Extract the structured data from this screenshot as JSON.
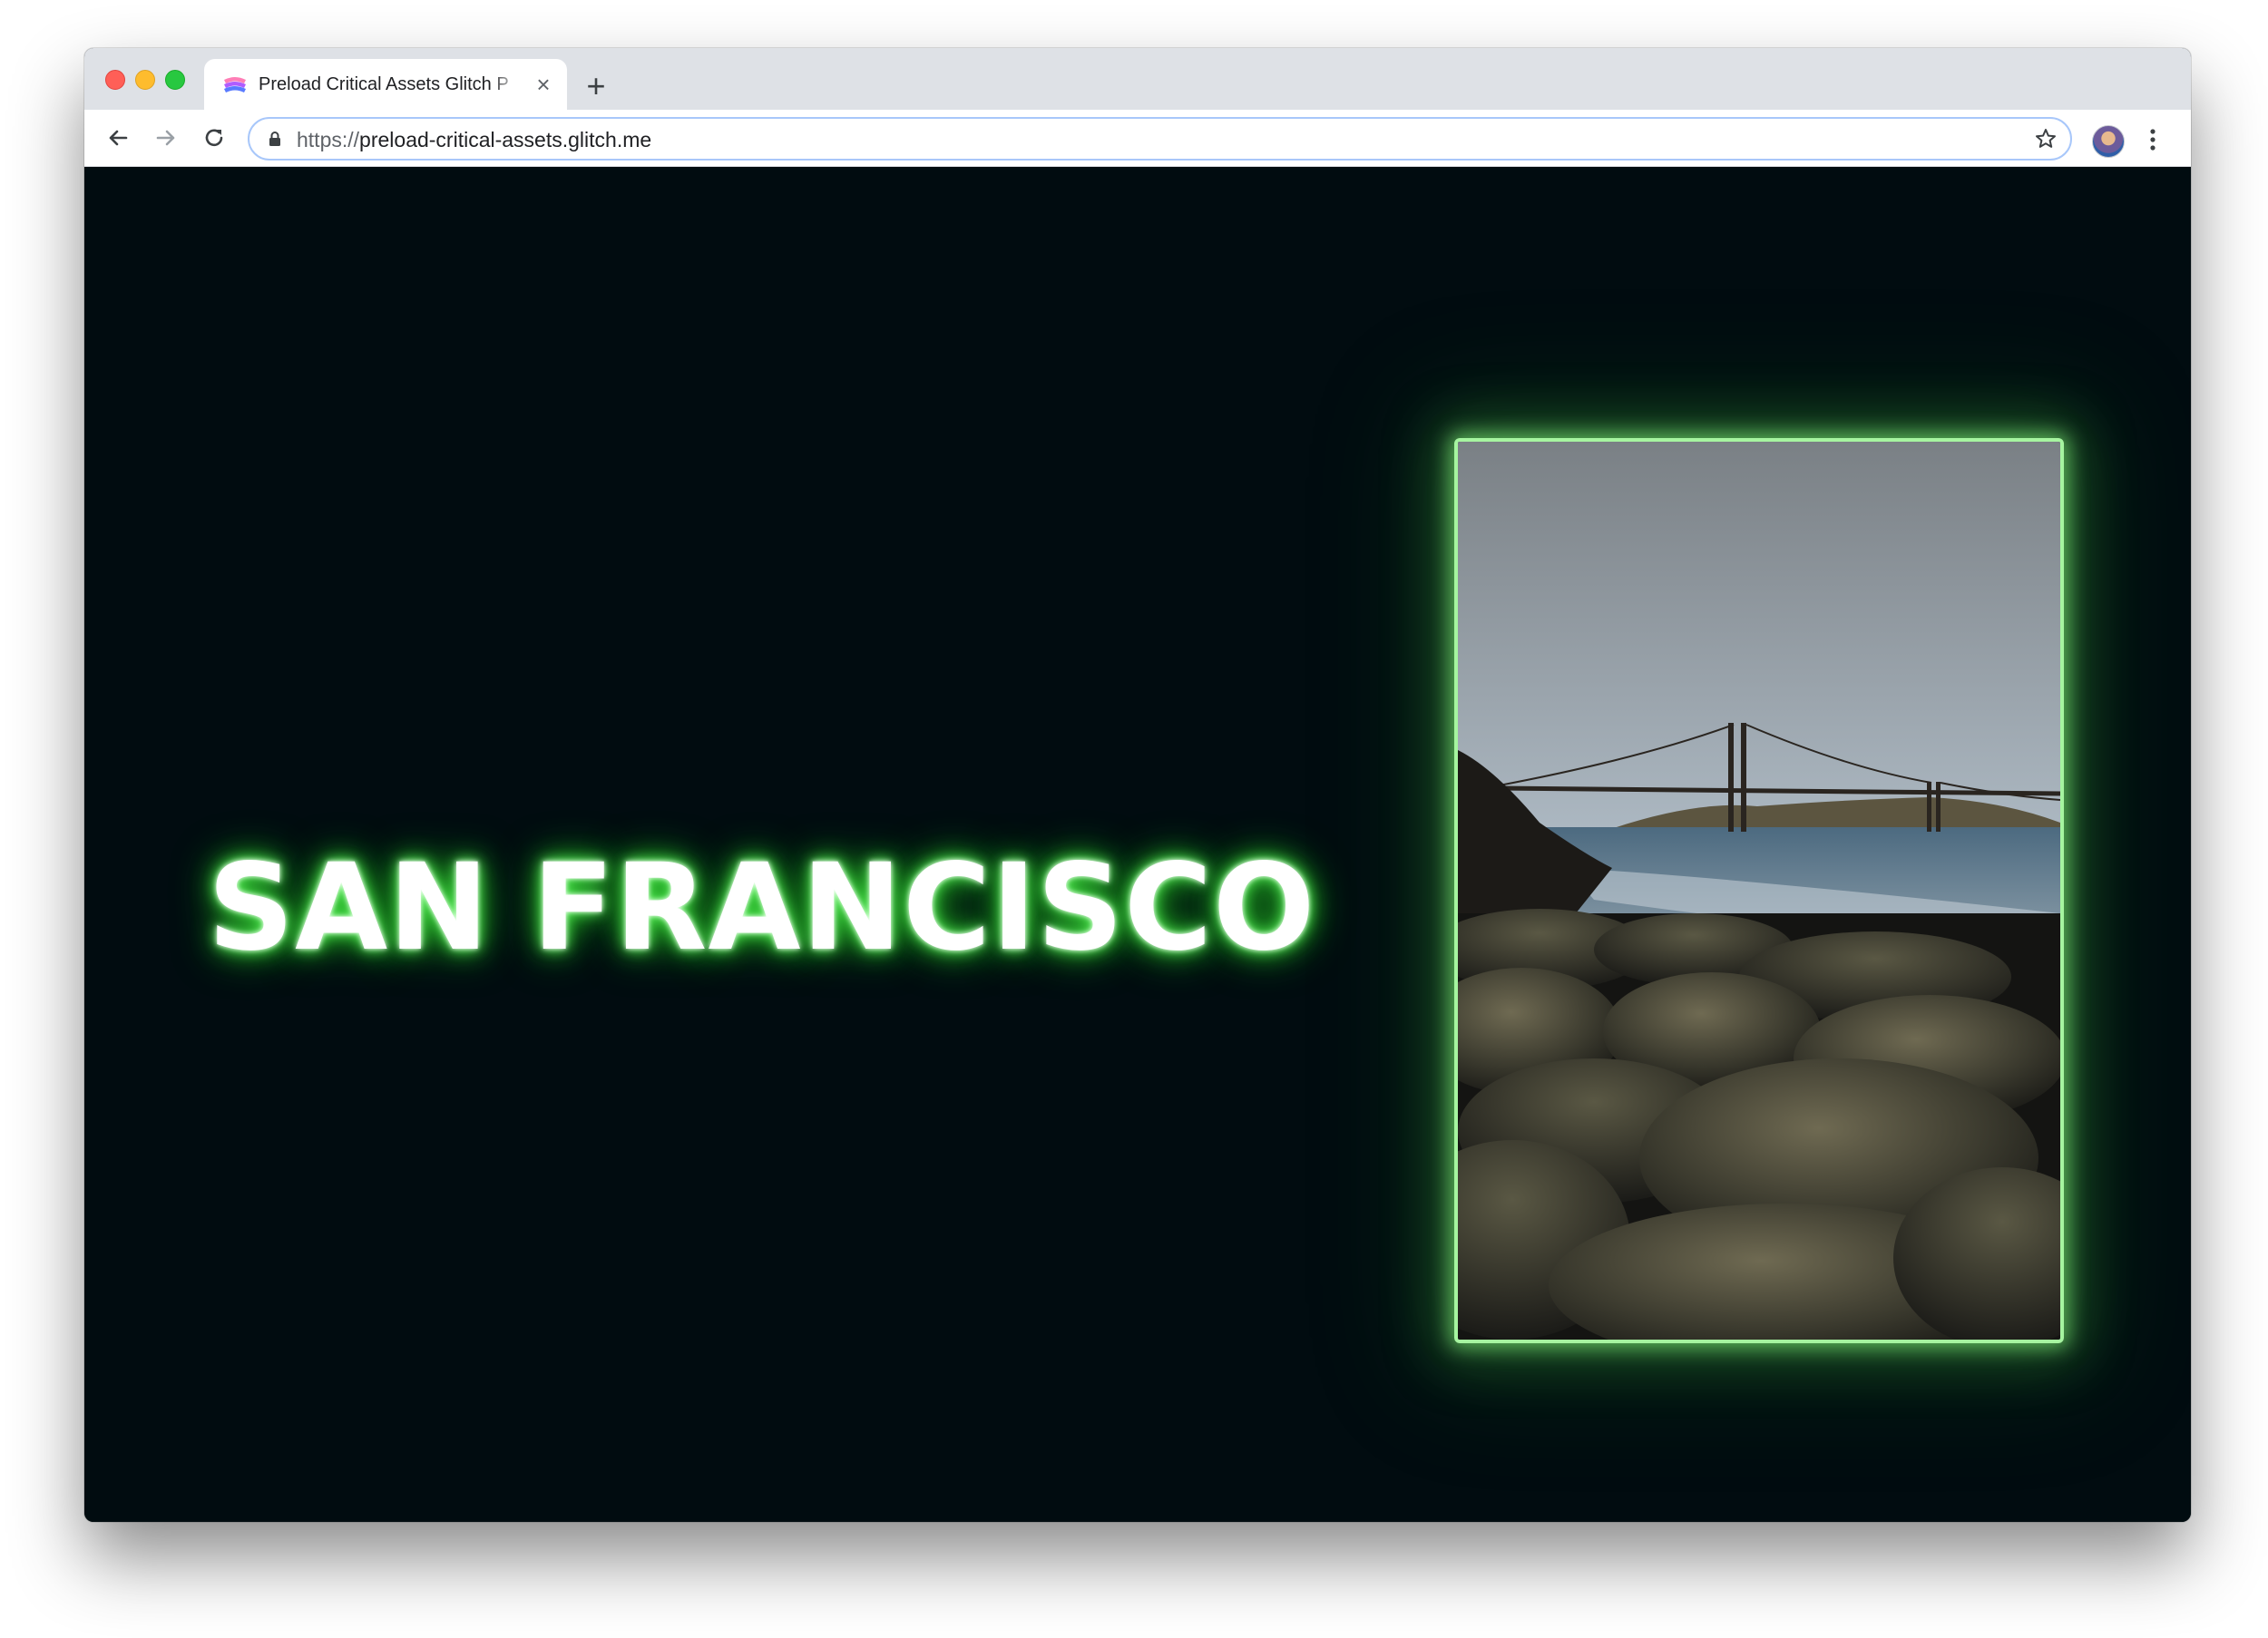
{
  "browser": {
    "tab": {
      "title": "Preload Critical Assets Glitch P",
      "favicon": "glitch-favicon-icon",
      "close_icon": "close-icon"
    },
    "new_tab_icon": "plus-icon",
    "toolbar": {
      "back_icon": "back-arrow-icon",
      "forward_icon": "forward-arrow-icon",
      "reload_icon": "reload-icon",
      "lock_icon": "lock-icon",
      "url_scheme": "https://",
      "url_host": "preload-critical-assets.glitch.me",
      "bookmark_icon": "star-icon",
      "profile_icon": "avatar",
      "menu_icon": "kebab-menu-icon"
    }
  },
  "page": {
    "headline": "SAN FRANCISCO",
    "image_description_icon": "golden-gate-bridge-photo",
    "colors": {
      "background": "#010c10",
      "glow": "#6eff6e",
      "frame_border": "#a6f5a0"
    }
  }
}
